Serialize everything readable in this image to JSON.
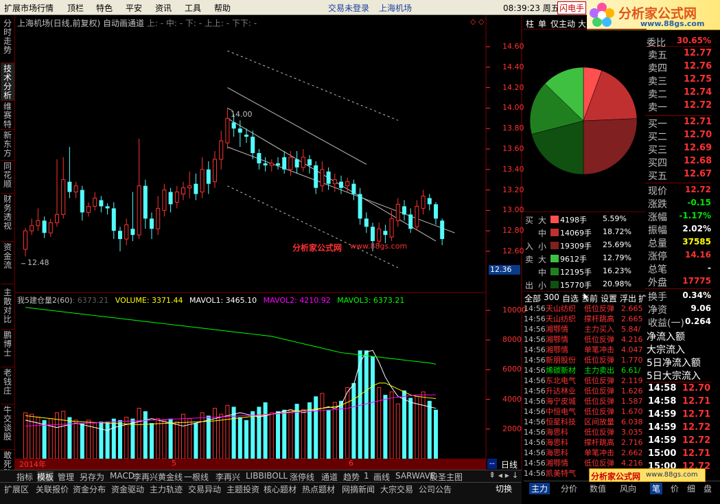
{
  "menubar": {
    "items": [
      "扩展市场行情",
      "顶栏",
      "特色",
      "平安",
      "资讯",
      "工具",
      "帮助"
    ],
    "trade_status": "交易未登录",
    "stock_name": "上海机场",
    "clock": "08:39:23 周五",
    "alert_button": "闪电手",
    "brand": "分析家公式网",
    "brand_url": "www.88gs.com"
  },
  "left_tabs": [
    "分时走势",
    "技术分析",
    "维赛特",
    "新东方",
    "同花顺",
    "财务透视",
    "资金流",
    "主散对比",
    "鹏博士",
    "老钱庄",
    "牛交谈股",
    "敢死队"
  ],
  "kline_title": {
    "name": "上海机场(日线,前复权)",
    "indicator": "自动画通道",
    "params": "上: - 中: - 下: - 上上: - 下下: -"
  },
  "kline_annotations": {
    "high": "14.00",
    "low": "12.48",
    "watermark": "分析家公式网",
    "watermark2": "www.88gs.com"
  },
  "price_axis": [
    "14.60",
    "14.40",
    "14.20",
    "14.00",
    "13.80",
    "13.60",
    "13.40",
    "13.20",
    "13.00",
    "12.80",
    "12.60"
  ],
  "current_price_tag": "12.36",
  "volume_title": {
    "name": "我5建仓量2(60)",
    "dim": ": 6373.21",
    "vol_label": "VOLUME: 3371.44",
    "mavol1": "MAVOL1: 3465.10",
    "mavol2": "MAVOL2: 4210.92",
    "mavol3": "MAVOL3: 6373.21"
  },
  "volume_axis": [
    "10000",
    "8000",
    "6000",
    "4000",
    "2000"
  ],
  "date_axis": [
    "2014年",
    "5",
    "6"
  ],
  "period_label": "日线",
  "colors": {
    "up": "#ff3232",
    "down": "#54fcfc",
    "ma1": "#ffffff",
    "ma2": "#ffff00",
    "ma3": "#ff00ff",
    "ma4": "#00ff00"
  },
  "quote_tabs": [
    "柱",
    "单",
    "仅主动",
    "大"
  ],
  "order_book": {
    "ratio_label": "委比",
    "ratio": "30.65%",
    "asks": [
      {
        "label": "卖五",
        "price": "12.77"
      },
      {
        "label": "卖四",
        "price": "12.76"
      },
      {
        "label": "卖三",
        "price": "12.75"
      },
      {
        "label": "卖二",
        "price": "12.74"
      },
      {
        "label": "卖一",
        "price": "12.72"
      }
    ],
    "bids": [
      {
        "label": "买一",
        "price": "12.71"
      },
      {
        "label": "买二",
        "price": "12.70"
      },
      {
        "label": "买三",
        "price": "12.69"
      },
      {
        "label": "买四",
        "price": "12.68"
      },
      {
        "label": "买五",
        "price": "12.67"
      }
    ]
  },
  "stats": [
    {
      "label": "现价",
      "value": "12.72",
      "color": "red"
    },
    {
      "label": "涨跌",
      "value": "-0.15",
      "color": "grn"
    },
    {
      "label": "涨幅",
      "value": "-1.17%",
      "color": "grn"
    },
    {
      "label": "振幅",
      "value": "2.02%",
      "color": "white"
    },
    {
      "label": "总量",
      "value": "37585",
      "color": "yel"
    },
    {
      "label": "涨停",
      "value": "14.16",
      "color": "red"
    },
    {
      "label": "总笔",
      "value": "-",
      "color": "white"
    },
    {
      "label": "外盘",
      "value": "17775",
      "color": "red"
    },
    {
      "label": "换手",
      "value": "0.34%",
      "color": "white"
    },
    {
      "label": "净资",
      "value": "9.06",
      "color": "white"
    },
    {
      "label": "收益(一)",
      "value": "0.264",
      "color": "white"
    }
  ],
  "flow_labels": [
    "净流入额",
    "大宗流入",
    "5日净流入额",
    "5日大宗流入"
  ],
  "flow_table": {
    "buy_label": [
      "买",
      "入"
    ],
    "sell_label": [
      "卖",
      "出"
    ],
    "rows": [
      {
        "size": "大",
        "volume": "4198手",
        "pct": "5.59%",
        "color": "#ff5050"
      },
      {
        "size": "中",
        "volume": "14069手",
        "pct": "18.72%",
        "color": "#c03030"
      },
      {
        "size": "小",
        "volume": "19309手",
        "pct": "25.69%",
        "color": "#802020"
      },
      {
        "size": "大",
        "volume": "9612手",
        "pct": "12.79%",
        "color": "#40c040"
      },
      {
        "size": "中",
        "volume": "12195手",
        "pct": "16.23%",
        "color": "#208020"
      },
      {
        "size": "小",
        "volume": "15770手",
        "pct": "20.98%",
        "color": "#105010"
      }
    ]
  },
  "radar_tabs": [
    "全部",
    "300",
    "自选",
    "当前",
    "设置",
    "浮出",
    "扩"
  ],
  "radar": [
    {
      "time": "14:56",
      "name": "天山纺织",
      "event": "低位反弹",
      "val": "2.665"
    },
    {
      "time": "14:56",
      "name": "天山纺织",
      "event": "撑杆跳高",
      "val": "2.665"
    },
    {
      "time": "14:56",
      "name": "湘鄂情",
      "event": "主力买入",
      "val": "5.84/"
    },
    {
      "time": "14:56",
      "name": "湘鄂情",
      "event": "低位反弹",
      "val": "4.216"
    },
    {
      "time": "14:56",
      "name": "湘鄂情",
      "event": "单笔冲击",
      "val": "4.047"
    },
    {
      "time": "14:56",
      "name": "新朋股份",
      "event": "低位反弹",
      "val": "1.770"
    },
    {
      "time": "14:56",
      "name": "烯碳新材",
      "event": "主力卖出",
      "val": "6.61/"
    },
    {
      "time": "14:56",
      "name": "东北电气",
      "event": "低位反弹",
      "val": "2.119"
    },
    {
      "time": "14:56",
      "name": "升达林业",
      "event": "低位反弹",
      "val": "1.626"
    },
    {
      "time": "14:56",
      "name": "海宁皮城",
      "event": "低位反弹",
      "val": "1.587"
    },
    {
      "time": "14:56",
      "name": "中恒电气",
      "event": "低位反弹",
      "val": "1.670"
    },
    {
      "time": "14:56",
      "name": "恒星科技",
      "event": "区间放量",
      "val": "6.038"
    },
    {
      "time": "14:56",
      "name": "海思科",
      "event": "低位反弹",
      "val": "3.035"
    },
    {
      "time": "14:56",
      "name": "海思科",
      "event": "撑杆跳高",
      "val": "2.716"
    },
    {
      "time": "14:56",
      "name": "海思科",
      "event": "单笔冲击",
      "val": "2.662"
    },
    {
      "time": "14:56",
      "name": "湘鄂情",
      "event": "低位反弹",
      "val": "4.216"
    },
    {
      "time": "14:56",
      "name": "凯美特气",
      "event": "",
      "val": ""
    }
  ],
  "ticks": [
    {
      "time": "14:58",
      "price": "12.70"
    },
    {
      "time": "14:58",
      "price": "12.71"
    },
    {
      "time": "14:59",
      "price": "12.71"
    },
    {
      "time": "14:59",
      "price": "12.72"
    },
    {
      "time": "14:59",
      "price": "12.72"
    },
    {
      "time": "15:00",
      "price": "12.71"
    },
    {
      "time": "15:00",
      "price": "12.72"
    }
  ],
  "indicator_bar": [
    "指标",
    "模板",
    "管理",
    "另存为",
    "MACD",
    "李再兴黄金线",
    "一根线",
    "李再兴",
    "LIBBIBOLL",
    "涨停线",
    "通道",
    "趋势",
    "1",
    "画线",
    "SARWAVE",
    "股圣主图"
  ],
  "status_tabs": [
    "扩展区",
    "关联报价",
    "资金分布",
    "资金驱动",
    "主力轨迹",
    "交易异动",
    "主题投资",
    "核心题材",
    "热点题材",
    "网摘新闻",
    "大宗交易",
    "公司公告"
  ],
  "status_right": [
    "切换"
  ],
  "right_bottom_tabs": [
    "主力",
    "分价",
    "数值",
    "风向",
    "笔",
    "价",
    "细",
    "盘"
  ],
  "chart_data": {
    "type": "candlestick",
    "title": "上海机场(日线,前复权)",
    "ylim": [
      12.4,
      14.7
    ],
    "candles": [
      {
        "o": 12.62,
        "c": 12.8,
        "h": 12.83,
        "l": 12.55
      },
      {
        "o": 12.8,
        "c": 12.85,
        "h": 12.92,
        "l": 12.76
      },
      {
        "o": 12.85,
        "c": 12.9,
        "h": 13.02,
        "l": 12.8
      },
      {
        "o": 12.9,
        "c": 12.78,
        "h": 12.94,
        "l": 12.73
      },
      {
        "o": 12.78,
        "c": 12.88,
        "h": 12.92,
        "l": 12.74
      },
      {
        "o": 12.88,
        "c": 12.96,
        "h": 13.5,
        "l": 12.84
      },
      {
        "o": 12.96,
        "c": 13.3,
        "h": 13.52,
        "l": 12.92
      },
      {
        "o": 13.28,
        "c": 13.18,
        "h": 13.62,
        "l": 13.12
      },
      {
        "o": 13.18,
        "c": 13.24,
        "h": 13.28,
        "l": 13.12
      },
      {
        "o": 13.2,
        "c": 12.98,
        "h": 13.24,
        "l": 12.9
      },
      {
        "o": 12.98,
        "c": 13.04,
        "h": 13.08,
        "l": 12.94
      },
      {
        "o": 13.04,
        "c": 13.12,
        "h": 13.18,
        "l": 13.0
      },
      {
        "o": 13.1,
        "c": 13.04,
        "h": 13.14,
        "l": 12.98
      },
      {
        "o": 13.04,
        "c": 13.02,
        "h": 13.07,
        "l": 12.96
      },
      {
        "o": 13.02,
        "c": 12.8,
        "h": 13.08,
        "l": 12.72
      },
      {
        "o": 12.8,
        "c": 12.72,
        "h": 12.84,
        "l": 12.6
      },
      {
        "o": 12.72,
        "c": 12.86,
        "h": 12.92,
        "l": 12.66
      },
      {
        "o": 12.82,
        "c": 12.76,
        "h": 13.18,
        "l": 12.7
      },
      {
        "o": 12.76,
        "c": 13.24,
        "h": 13.7,
        "l": 12.72
      },
      {
        "o": 13.24,
        "c": 12.92,
        "h": 13.3,
        "l": 12.82
      },
      {
        "o": 12.92,
        "c": 12.82,
        "h": 12.98,
        "l": 12.72
      },
      {
        "o": 12.82,
        "c": 13.02,
        "h": 13.14,
        "l": 12.76
      },
      {
        "o": 13.0,
        "c": 13.2,
        "h": 13.26,
        "l": 12.94
      },
      {
        "o": 13.18,
        "c": 13.06,
        "h": 13.22,
        "l": 12.98
      },
      {
        "o": 13.08,
        "c": 13.18,
        "h": 13.24,
        "l": 13.02
      },
      {
        "o": 13.16,
        "c": 13.22,
        "h": 13.28,
        "l": 13.1
      },
      {
        "o": 13.22,
        "c": 13.24,
        "h": 13.38,
        "l": 13.12
      },
      {
        "o": 13.26,
        "c": 13.16,
        "h": 13.36,
        "l": 13.1
      },
      {
        "o": 13.18,
        "c": 13.4,
        "h": 13.52,
        "l": 13.12
      },
      {
        "o": 13.4,
        "c": 13.26,
        "h": 13.48,
        "l": 13.16
      },
      {
        "o": 13.28,
        "c": 13.5,
        "h": 13.58,
        "l": 13.22
      },
      {
        "o": 13.5,
        "c": 13.68,
        "h": 13.78,
        "l": 13.4
      },
      {
        "o": 13.66,
        "c": 13.9,
        "h": 14.0,
        "l": 13.6
      },
      {
        "o": 13.86,
        "c": 13.8,
        "h": 13.94,
        "l": 13.72
      },
      {
        "o": 13.8,
        "c": 13.76,
        "h": 13.88,
        "l": 13.62
      },
      {
        "o": 13.74,
        "c": 13.72,
        "h": 13.8,
        "l": 13.66
      },
      {
        "o": 13.72,
        "c": 13.56,
        "h": 13.78,
        "l": 13.5
      },
      {
        "o": 13.56,
        "c": 13.46,
        "h": 13.6,
        "l": 13.4
      },
      {
        "o": 13.46,
        "c": 13.44,
        "h": 13.52,
        "l": 13.38
      },
      {
        "o": 13.44,
        "c": 13.46,
        "h": 13.5,
        "l": 13.38
      },
      {
        "o": 13.46,
        "c": 13.44,
        "h": 13.52,
        "l": 13.4
      },
      {
        "o": 13.52,
        "c": 13.4,
        "h": 13.58,
        "l": 13.36
      },
      {
        "o": 13.4,
        "c": 13.52,
        "h": 13.58,
        "l": 13.34
      },
      {
        "o": 13.5,
        "c": 13.42,
        "h": 13.58,
        "l": 13.36
      },
      {
        "o": 13.42,
        "c": 13.52,
        "h": 13.6,
        "l": 13.38
      },
      {
        "o": 13.5,
        "c": 13.44,
        "h": 13.54,
        "l": 13.36
      },
      {
        "o": 13.44,
        "c": 13.22,
        "h": 13.48,
        "l": 13.16
      },
      {
        "o": 13.24,
        "c": 13.4,
        "h": 13.48,
        "l": 13.18
      },
      {
        "o": 13.38,
        "c": 13.26,
        "h": 13.42,
        "l": 13.2
      },
      {
        "o": 13.26,
        "c": 13.3,
        "h": 13.36,
        "l": 13.18
      },
      {
        "o": 13.28,
        "c": 13.22,
        "h": 13.34,
        "l": 13.16
      },
      {
        "o": 13.24,
        "c": 13.28,
        "h": 13.32,
        "l": 13.18
      },
      {
        "o": 13.26,
        "c": 13.16,
        "h": 13.3,
        "l": 13.1
      },
      {
        "o": 13.16,
        "c": 12.92,
        "h": 13.22,
        "l": 12.86
      },
      {
        "o": 12.92,
        "c": 12.84,
        "h": 12.98,
        "l": 12.78
      },
      {
        "o": 12.84,
        "c": 12.7,
        "h": 12.88,
        "l": 12.6
      },
      {
        "o": 12.7,
        "c": 12.82,
        "h": 12.88,
        "l": 12.64
      },
      {
        "o": 12.8,
        "c": 12.76,
        "h": 12.86,
        "l": 12.68
      },
      {
        "o": 12.74,
        "c": 12.92,
        "h": 13.0,
        "l": 12.7
      },
      {
        "o": 12.9,
        "c": 13.06,
        "h": 13.12,
        "l": 12.84
      },
      {
        "o": 13.04,
        "c": 12.96,
        "h": 13.1,
        "l": 12.9
      },
      {
        "o": 12.96,
        "c": 12.82,
        "h": 13.02,
        "l": 12.78
      },
      {
        "o": 12.84,
        "c": 13.04,
        "h": 13.1,
        "l": 12.8
      },
      {
        "o": 13.02,
        "c": 13.14,
        "h": 13.2,
        "l": 12.96
      },
      {
        "o": 13.12,
        "c": 13.06,
        "h": 13.16,
        "l": 13.0
      },
      {
        "o": 13.06,
        "c": 12.92,
        "h": 13.08,
        "l": 12.86
      },
      {
        "o": 12.9,
        "c": 12.72,
        "h": 12.92,
        "l": 12.66
      }
    ],
    "channel": {
      "upper": [
        [
          32,
          14.2
        ],
        [
          54,
          13.45
        ]
      ],
      "middle": [
        [
          32,
          13.9
        ],
        [
          65,
          12.7
        ]
      ],
      "lower": [
        [
          32,
          13.6
        ],
        [
          54,
          12.5
        ]
      ]
    },
    "volume": [
      3100,
      3000,
      2800,
      2600,
      2700,
      3100,
      3200,
      2800,
      2600,
      2400,
      2600,
      2400,
      2500,
      2500,
      2700,
      2600,
      2800,
      2700,
      3400,
      3200,
      2400,
      2700,
      2600,
      2700,
      2500,
      3000,
      2700,
      2400,
      3100,
      2900,
      3400,
      3000,
      3600,
      3500,
      2800,
      2600,
      3200,
      3500,
      3800,
      3100,
      3200,
      3300,
      3300,
      3700,
      3300,
      3800,
      4200,
      4400,
      3300,
      3800,
      3900,
      4800,
      5100,
      7300,
      7300,
      6900,
      4800,
      4300,
      4500,
      3700,
      4600,
      4100,
      4200,
      4500,
      3900,
      3300
    ],
    "volume_ylim": [
      0,
      10000
    ],
    "mavol": {
      "ma1": [
        2600,
        2500,
        2400,
        2300,
        2200,
        2100,
        2200,
        2300,
        2400,
        2300,
        2200,
        2100,
        2000,
        1900,
        2100,
        2200,
        2300,
        2400,
        2500,
        2600,
        2700,
        2600,
        2500,
        2400,
        2300,
        2200,
        2300,
        2400,
        2500,
        2600,
        2700,
        2800,
        2900,
        3000,
        3100,
        3000,
        2900,
        2800,
        2900,
        3000,
        3100,
        3200,
        3300,
        3200,
        3100,
        3200,
        3300,
        3400,
        3500,
        3400,
        3600,
        4500,
        5000,
        6500,
        7200,
        7300,
        6500,
        5500,
        4800,
        4200,
        4000,
        3800,
        3700,
        3600,
        3500,
        3400
      ],
      "ma2": [
        2900,
        2850,
        2800,
        2750,
        2700,
        2650,
        2600,
        2550,
        2500,
        2480,
        2460,
        2440,
        2420,
        2400,
        2380,
        2360,
        2340,
        2320,
        2300,
        2320,
        2340,
        2360,
        2380,
        2400,
        2420,
        2440,
        2460,
        2480,
        2500,
        2520,
        2550,
        2600,
        2650,
        2700,
        2750,
        2800,
        2850,
        2900,
        2950,
        3000,
        3050,
        3100,
        3150,
        3200,
        3250,
        3300,
        3350,
        3400,
        3450,
        3500,
        3600,
        3800,
        4000,
        4300,
        4600,
        4900,
        5100,
        5100,
        4900,
        4700,
        4500,
        4300,
        4200,
        4150,
        4100,
        4050
      ],
      "ma3": [
        2200,
        2220,
        2240,
        2260,
        2280,
        2300,
        2320,
        2340,
        2360,
        2380,
        2400,
        2420,
        2440,
        2460,
        2480,
        2500,
        2520,
        2540,
        2560,
        2580,
        2600,
        2620,
        2640,
        2660,
        2680,
        2700,
        2720,
        2740,
        2760,
        2780,
        2800,
        2820,
        2840,
        2860,
        2880,
        2900,
        2920,
        2950,
        2980,
        3010,
        3040,
        3070,
        3100,
        3130,
        3160,
        3190,
        3220,
        3250,
        3280,
        3310,
        3350,
        3400,
        3500,
        3600,
        3700,
        3800,
        3900,
        4000,
        4100,
        4150,
        4200,
        4250,
        4300,
        4300,
        4300,
        4300
      ],
      "ma4": [
        10200,
        10150,
        10100,
        10050,
        10000,
        9950,
        9900,
        9850,
        9800,
        9750,
        9700,
        9650,
        9600,
        9550,
        9500,
        9450,
        9400,
        9350,
        9300,
        9250,
        9200,
        9150,
        9100,
        9050,
        9000,
        8950,
        8900,
        8850,
        8800,
        8750,
        8700,
        8650,
        8600,
        8550,
        8500,
        8450,
        8400,
        8350,
        8300,
        8250,
        8150,
        8050,
        7950,
        7850,
        7750,
        7650,
        7550,
        7450,
        7350,
        7250,
        7150,
        7100,
        7050,
        7000,
        6950,
        6900,
        6850,
        6800,
        6750,
        6700,
        6650,
        6600,
        6550,
        6500,
        6450,
        6373
      ]
    }
  }
}
